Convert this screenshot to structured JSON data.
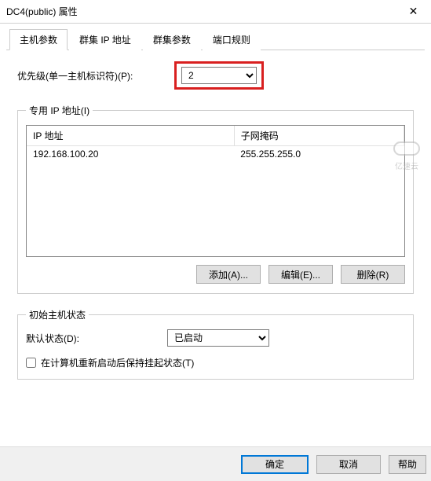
{
  "window": {
    "title": "DC4(public) 属性"
  },
  "tabs": {
    "items": [
      {
        "label": "主机参数"
      },
      {
        "label": "群集 IP 地址"
      },
      {
        "label": "群集参数"
      },
      {
        "label": "端口规则"
      }
    ]
  },
  "priority": {
    "label": "优先级(单一主机标识符)(P):",
    "value": "2"
  },
  "ipGroup": {
    "legend": "专用 IP 地址(I)",
    "columns": {
      "ip": "IP 地址",
      "mask": "子网掩码"
    },
    "rows": [
      {
        "ip": "192.168.100.20",
        "mask": "255.255.255.0"
      }
    ],
    "buttons": {
      "add": "添加(A)...",
      "edit": "编辑(E)...",
      "remove": "删除(R)"
    }
  },
  "stateGroup": {
    "legend": "初始主机状态",
    "defaultLabel": "默认状态(D):",
    "defaultValue": "已启动",
    "retainLabel": "在计算机重新启动后保持挂起状态(T)",
    "retainChecked": false
  },
  "footer": {
    "ok": "确定",
    "cancel": "取消",
    "help": "帮助"
  },
  "watermark": {
    "text": "亿速云"
  }
}
